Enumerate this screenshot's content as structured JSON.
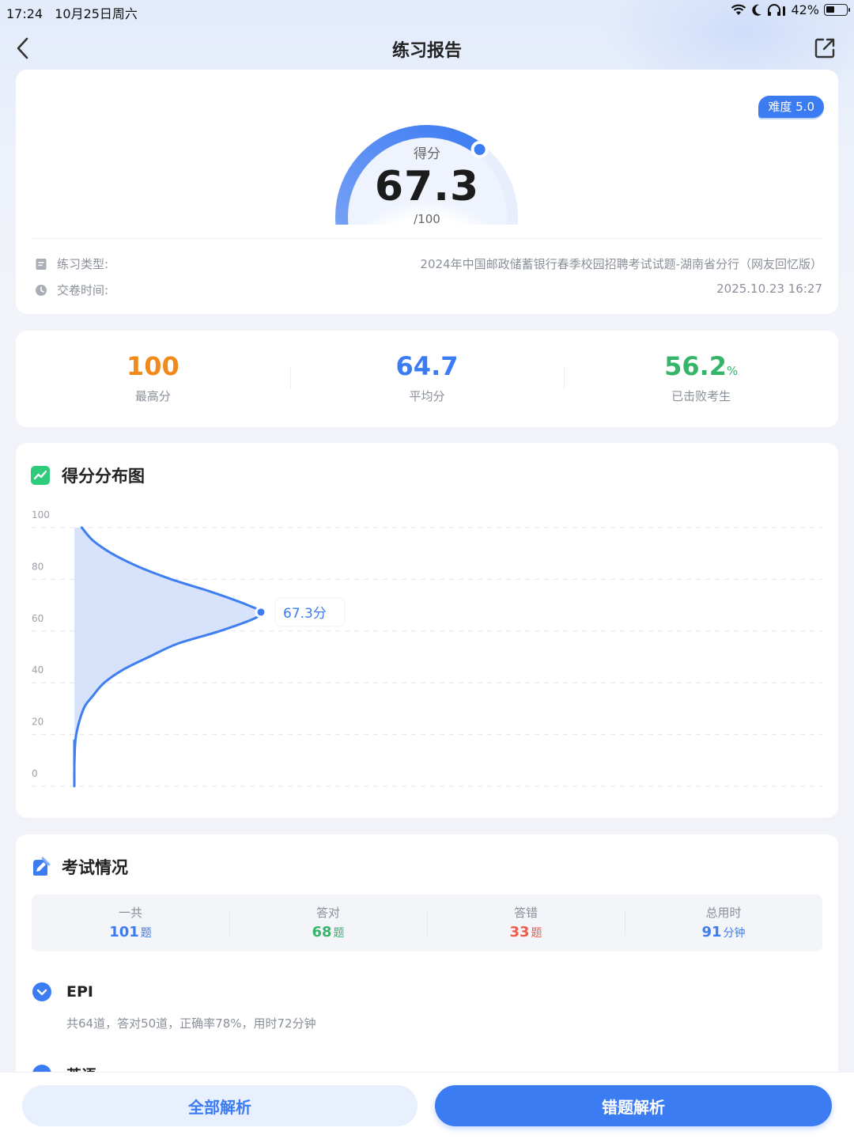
{
  "status_bar": {
    "time": "17:24",
    "date": "10月25日周六",
    "battery": "42%",
    "battery_level": 0.42
  },
  "nav": {
    "title": "练习报告",
    "back_icon": "chevron-left-icon",
    "share_icon": "share-icon"
  },
  "score": {
    "difficulty": "难度 5.0",
    "label": "得分",
    "value": "67.3",
    "total": "/100",
    "fraction": 0.673
  },
  "info": {
    "type_label": "练习类型:",
    "type_value": "2024年中国邮政储蓄银行春季校园招聘考试试题-湖南省分行（网友回忆版）",
    "time_label": "交卷时间:",
    "time_value": "2025.10.23 16:27"
  },
  "stats": [
    {
      "value": "100",
      "unit": "",
      "label": "最高分",
      "color": "#f08a1c"
    },
    {
      "value": "64.7",
      "unit": "",
      "label": "平均分",
      "color": "#3c7cf2"
    },
    {
      "value": "56.2",
      "unit": "%",
      "label": "已击败考生",
      "color": "#35b56a"
    }
  ],
  "distribution": {
    "title": "得分分布图",
    "marker_label": "67.3分"
  },
  "chart_data": {
    "type": "area",
    "title": "得分分布图",
    "xlabel": "",
    "ylabel": "",
    "ylim": [
      0,
      100
    ],
    "yticks": [
      0,
      20,
      40,
      60,
      80,
      100
    ],
    "y": [
      0,
      10,
      20,
      30,
      35,
      40,
      45,
      50,
      55,
      60,
      64.7,
      67.3,
      70,
      75,
      80,
      85,
      90,
      95,
      100
    ],
    "density": [
      0,
      0.001,
      0.01,
      0.05,
      0.1,
      0.16,
      0.26,
      0.4,
      0.55,
      0.78,
      0.96,
      1.0,
      0.93,
      0.74,
      0.52,
      0.34,
      0.2,
      0.1,
      0.04
    ],
    "marker": {
      "score": 67.3,
      "label": "67.3分"
    },
    "grid": true,
    "colors": {
      "line": "#3f7ef0",
      "fill": "#d6e3fb"
    }
  },
  "exam": {
    "title": "考试情况",
    "summary": [
      {
        "label": "一共",
        "value": "101",
        "unit": "题",
        "color": "#3c7cf2"
      },
      {
        "label": "答对",
        "value": "68",
        "unit": "题",
        "color": "#35b56a"
      },
      {
        "label": "答错",
        "value": "33",
        "unit": "题",
        "color": "#ef5b4a"
      },
      {
        "label": "总用时",
        "value": "91",
        "unit": "分钟",
        "color": "#3c7cf2"
      }
    ],
    "sections": [
      {
        "name": "EPI",
        "desc": "共64道，答对50道，正确率78%，用时72分钟"
      },
      {
        "name": "英语",
        "desc": ""
      }
    ]
  },
  "buttons": {
    "all": "全部解析",
    "wrong": "错题解析"
  }
}
